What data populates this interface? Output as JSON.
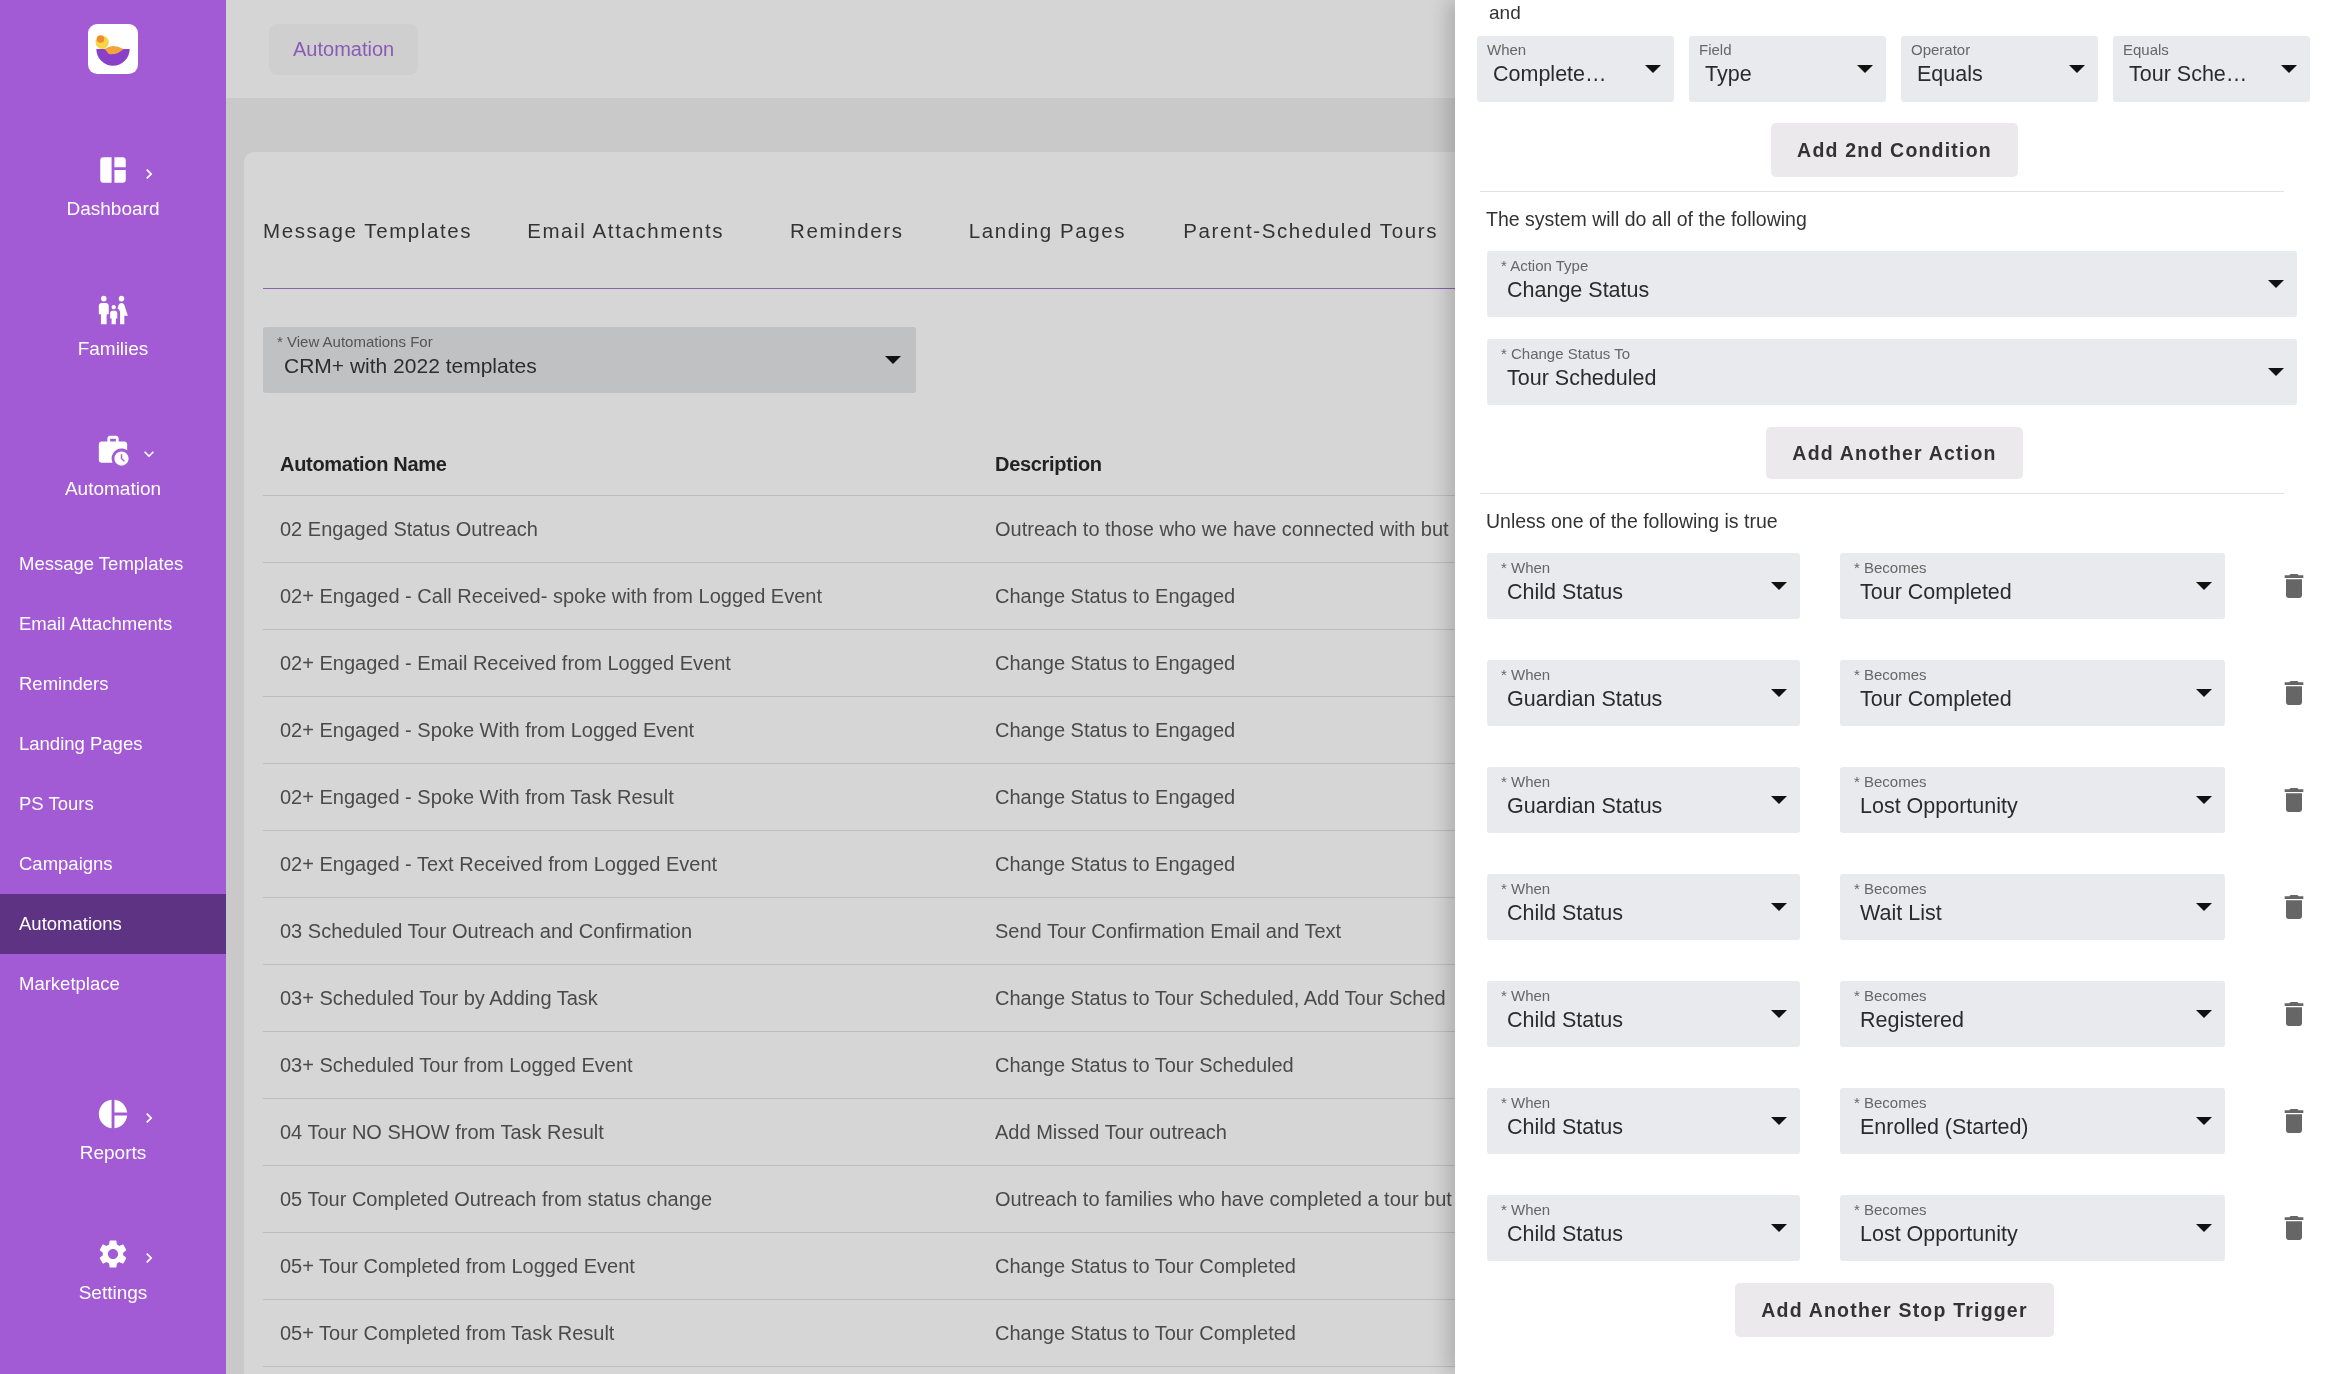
{
  "sidebar": {
    "sections": [
      {
        "label": "Dashboard",
        "kind": "group",
        "expanded": false
      },
      {
        "label": "Families",
        "kind": "link"
      },
      {
        "label": "Automation",
        "kind": "group",
        "expanded": true,
        "children": [
          {
            "label": "Message Templates",
            "selected": false
          },
          {
            "label": "Email Attachments",
            "selected": false
          },
          {
            "label": "Reminders",
            "selected": false
          },
          {
            "label": "Landing Pages",
            "selected": false
          },
          {
            "label": "PS Tours",
            "selected": false
          },
          {
            "label": "Campaigns",
            "selected": false
          },
          {
            "label": "Automations",
            "selected": true
          },
          {
            "label": "Marketplace",
            "selected": false
          }
        ]
      },
      {
        "label": "Reports",
        "kind": "group",
        "expanded": false
      },
      {
        "label": "Settings",
        "kind": "group",
        "expanded": false
      }
    ]
  },
  "breadcrumb": "Automation",
  "tabs": [
    {
      "label": "Message Templates",
      "selected": false
    },
    {
      "label": "Email Attachments",
      "selected": false
    },
    {
      "label": "Reminders",
      "selected": false
    },
    {
      "label": "Landing Pages",
      "selected": false
    },
    {
      "label": "Parent-Scheduled Tours",
      "selected": false
    }
  ],
  "filter": {
    "label": "* View Automations For",
    "value": "CRM+ with 2022 templates"
  },
  "table": {
    "columns": [
      "Automation Name",
      "Description"
    ],
    "rows": [
      [
        "02 Engaged Status Outreach",
        "Outreach to those who we have connected with but"
      ],
      [
        "02+ Engaged - Call Received- spoke with from Logged Event",
        "Change Status to Engaged"
      ],
      [
        "02+ Engaged - Email Received from Logged Event",
        "Change Status to Engaged"
      ],
      [
        "02+ Engaged - Spoke With from Logged Event",
        "Change Status to Engaged"
      ],
      [
        "02+ Engaged - Spoke With from Task Result",
        "Change Status to Engaged"
      ],
      [
        "02+ Engaged - Text Received from Logged Event",
        "Change Status to Engaged"
      ],
      [
        "03 Scheduled Tour Outreach and Confirmation",
        "Send Tour Confirmation Email and Text"
      ],
      [
        "03+ Scheduled Tour by Adding Task",
        "Change Status to Tour Scheduled, Add Tour Sched"
      ],
      [
        "03+ Scheduled Tour from Logged Event",
        "Change Status to Tour Scheduled"
      ],
      [
        "04 Tour NO SHOW from Task Result",
        "Add Missed Tour outreach"
      ],
      [
        "05 Tour Completed Outreach from status change",
        "Outreach to families who have completed a tour but"
      ],
      [
        "05+ Tour Completed from Logged Event",
        "Change Status to Tour Completed"
      ],
      [
        "05+ Tour Completed from Task Result",
        "Change Status to Tour Completed"
      ]
    ]
  },
  "drawer": {
    "connector": "and",
    "condition": [
      {
        "label": "When",
        "value": "Complete…"
      },
      {
        "label": "Field",
        "value": "Type"
      },
      {
        "label": "Operator",
        "value": "Equals"
      },
      {
        "label": "Equals",
        "value": "Tour Sche…"
      }
    ],
    "add_condition_button": "Add 2nd Condition",
    "actions_heading": "The system will do all of the following",
    "actions": [
      {
        "label": "* Action Type",
        "value": "Change Status"
      },
      {
        "label": "* Change Status To",
        "value": "Tour Scheduled"
      }
    ],
    "add_action_button": "Add Another Action",
    "stop_heading": "Unless one of the following is true",
    "stop_triggers": [
      {
        "when_label": "* When",
        "when": "Child Status",
        "becomes_label": "* Becomes",
        "becomes": "Tour Completed"
      },
      {
        "when_label": "* When",
        "when": "Guardian Status",
        "becomes_label": "* Becomes",
        "becomes": "Tour Completed"
      },
      {
        "when_label": "* When",
        "when": "Guardian Status",
        "becomes_label": "* Becomes",
        "becomes": "Lost Opportunity"
      },
      {
        "when_label": "* When",
        "when": "Child Status",
        "becomes_label": "* Becomes",
        "becomes": "Wait List"
      },
      {
        "when_label": "* When",
        "when": "Child Status",
        "becomes_label": "* Becomes",
        "becomes": "Registered"
      },
      {
        "when_label": "* When",
        "when": "Child Status",
        "becomes_label": "* Becomes",
        "becomes": "Enrolled (Started)"
      },
      {
        "when_label": "* When",
        "when": "Child Status",
        "becomes_label": "* Becomes",
        "becomes": "Lost Opportunity"
      }
    ],
    "add_stop_button": "Add Another Stop Trigger"
  }
}
